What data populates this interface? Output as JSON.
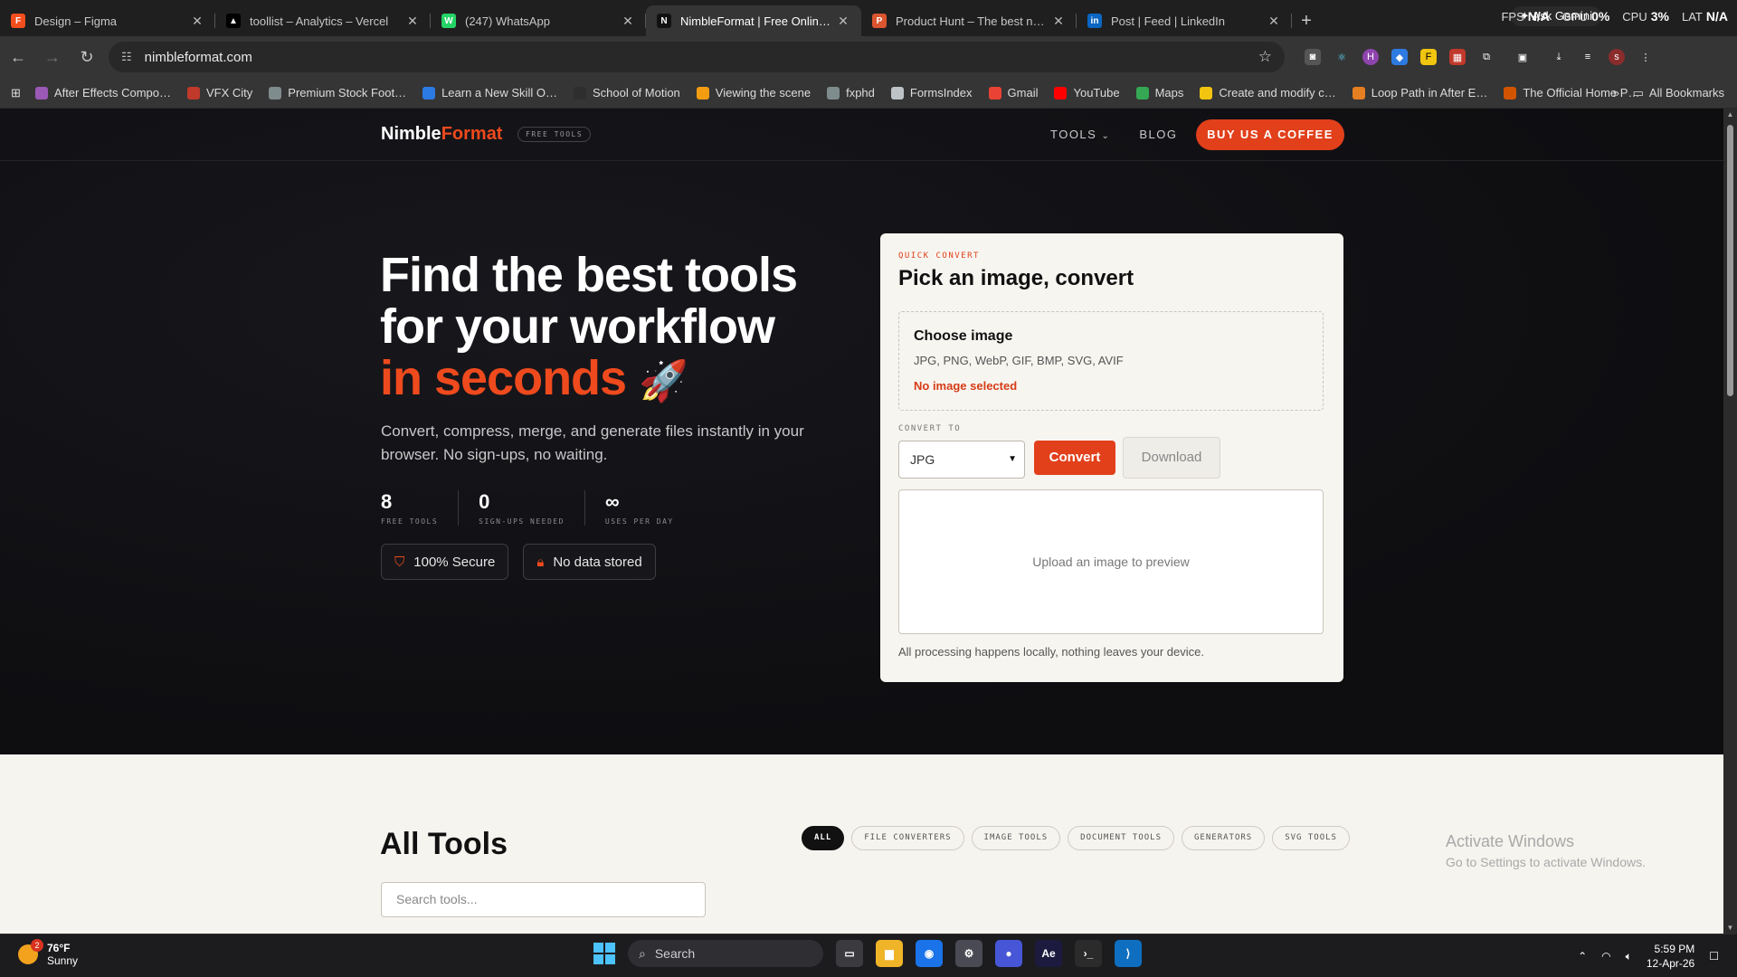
{
  "browser": {
    "tabs": [
      {
        "title": "Design – Figma",
        "icon": "figma-icon",
        "color": "#f24e1e",
        "glyph": "F"
      },
      {
        "title": "toollist – Analytics – Vercel",
        "icon": "vercel-icon",
        "color": "#000000",
        "glyph": "▲"
      },
      {
        "title": "(247) WhatsApp",
        "icon": "whatsapp-icon",
        "color": "#25d366",
        "glyph": "W"
      },
      {
        "title": "NimbleFormat | Free Online Im…",
        "icon": "nimbleformat-icon",
        "color": "#111111",
        "glyph": "N"
      },
      {
        "title": "Product Hunt – The best new p…",
        "icon": "producthunt-icon",
        "color": "#da552f",
        "glyph": "P"
      },
      {
        "title": "Post | Feed | LinkedIn",
        "icon": "linkedin-icon",
        "color": "#0a66c2",
        "glyph": "in"
      }
    ],
    "active_tab": 3,
    "ask_gemini": "Ask Gemini",
    "sysmon": {
      "fps_label": "FPS",
      "fps": "N/A",
      "gpu_label": "GPU",
      "gpu": "0%",
      "cpu_label": "CPU",
      "cpu": "3%",
      "lat_label": "LAT",
      "lat": "N/A"
    },
    "url": "nimbleformat.com",
    "bookmarks": [
      {
        "label": "After Effects Compo…",
        "color": "#9b59b6"
      },
      {
        "label": "VFX City",
        "color": "#c0392b"
      },
      {
        "label": "Premium Stock Foot…",
        "color": "#7f8c8d"
      },
      {
        "label": "Learn a New Skill O…",
        "color": "#2c7be5"
      },
      {
        "label": "School of Motion",
        "color": "#2e2e2e"
      },
      {
        "label": "Viewing the scene",
        "color": "#f39c12"
      },
      {
        "label": "fxphd",
        "color": "#7f8c8d"
      },
      {
        "label": "FormsIndex",
        "color": "#bdc3c7"
      },
      {
        "label": "Gmail",
        "color": "#ea4335"
      },
      {
        "label": "YouTube",
        "color": "#ff0000"
      },
      {
        "label": "Maps",
        "color": "#34a853"
      },
      {
        "label": "Create and modify c…",
        "color": "#f1c40f"
      },
      {
        "label": "Loop Path in After E…",
        "color": "#e67e22"
      },
      {
        "label": "The Official Home P…",
        "color": "#d35400"
      }
    ],
    "all_bookmarks": "All Bookmarks"
  },
  "site": {
    "logo_a": "Nimble",
    "logo_b": "Format",
    "free_tag": "FREE TOOLS",
    "nav_tools": "TOOLS",
    "nav_blog": "BLOG",
    "cta": "BUY US A COFFEE",
    "brand_color": "#e1401b",
    "hero": {
      "line1": "Find the best tools",
      "line2": "for your workflow",
      "line3": "in seconds",
      "emoji": "🚀",
      "lead": "Convert, compress, merge, and generate files instantly in your browser. No sign-ups, no waiting.",
      "stats": [
        {
          "value": "8",
          "label": "FREE TOOLS"
        },
        {
          "value": "0",
          "label": "SIGN-UPS NEEDED"
        },
        {
          "value": "∞",
          "label": "USES PER DAY"
        }
      ],
      "badges": [
        {
          "label": "100% Secure",
          "icon": "shield-icon"
        },
        {
          "label": "No data stored",
          "icon": "lock-icon"
        }
      ]
    },
    "converter": {
      "kicker": "QUICK CONVERT",
      "title": "Pick an image, convert",
      "choose": "Choose image",
      "formats": "JPG, PNG, WebP, GIF, BMP, SVG, AVIF",
      "status": "No image selected",
      "convert_to_label": "CONVERT TO",
      "selected_format": "JPG",
      "convert_btn": "Convert",
      "download_btn": "Download",
      "preview_placeholder": "Upload an image to preview",
      "note": "All processing happens locally, nothing leaves your device."
    },
    "tools": {
      "title": "All Tools",
      "filters": [
        "ALL",
        "FILE CONVERTERS",
        "IMAGE TOOLS",
        "DOCUMENT TOOLS",
        "GENERATORS",
        "SVG TOOLS"
      ],
      "active_filter": 0,
      "search_placeholder": "Search tools..."
    },
    "watermark": {
      "line1": "Activate Windows",
      "line2": "Go to Settings to activate Windows."
    }
  },
  "taskbar": {
    "temp": "76°F",
    "condition": "Sunny",
    "weather_badge": "2",
    "search": "Search",
    "time": "5:59 PM",
    "date": "12-Apr-26",
    "apps": [
      {
        "name": "task-view-icon",
        "color": "#3a3a3f",
        "glyph": "▭"
      },
      {
        "name": "file-explorer-icon",
        "color": "#f0b429",
        "glyph": "▆"
      },
      {
        "name": "chrome-icon",
        "color": "#1a73e8",
        "glyph": "◉"
      },
      {
        "name": "settings-icon",
        "color": "#4a4a55",
        "glyph": "⚙"
      },
      {
        "name": "app-icon",
        "color": "#4656d6",
        "glyph": "●"
      },
      {
        "name": "after-effects-icon",
        "color": "#1c1a3e",
        "glyph": "Ae"
      },
      {
        "name": "terminal-icon",
        "color": "#2b2b2b",
        "glyph": "›_"
      },
      {
        "name": "vscode-icon",
        "color": "#0e6fc0",
        "glyph": "⟩"
      }
    ]
  }
}
